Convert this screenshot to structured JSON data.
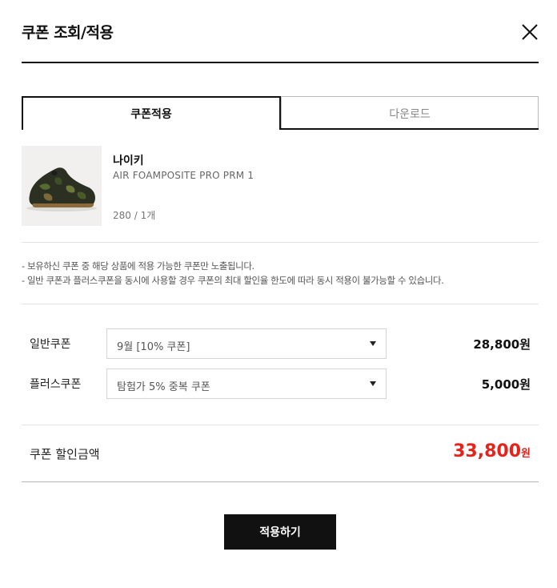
{
  "modal": {
    "title": "쿠폰 조회/적용",
    "close_icon": "close-icon"
  },
  "tabs": [
    {
      "label": "쿠폰적용",
      "active": true
    },
    {
      "label": "다운로드",
      "active": false
    }
  ],
  "product": {
    "brand": "나이키",
    "model": "AIR FOAMPOSITE PRO PRM 1",
    "option": "280 / 1개",
    "image_icon": "sneaker-image"
  },
  "notice": [
    "- 보유하신 쿠폰 중 해당 상품에 적용 가능한 쿠폰만 노출됩니다.",
    "- 일반 쿠폰과 플러스쿠폰을 동시에 사용할 경우 쿠폰의 최대 할인율 한도에 따라 동시 적용이 불가능할 수 있습니다."
  ],
  "coupons": [
    {
      "label": "일반쿠폰",
      "selected": "9월 [10% 쿠폰]",
      "amount": "28,800원"
    },
    {
      "label": "플러스쿠폰",
      "selected": "탐험가 5% 중복 쿠폰",
      "amount": "5,000원"
    }
  ],
  "total": {
    "label": "쿠폰 할인금액",
    "amount": "33,800",
    "unit": "원"
  },
  "apply_button": "적용하기",
  "colors": {
    "accent_red": "#e5231b",
    "primary_black": "#111111"
  }
}
